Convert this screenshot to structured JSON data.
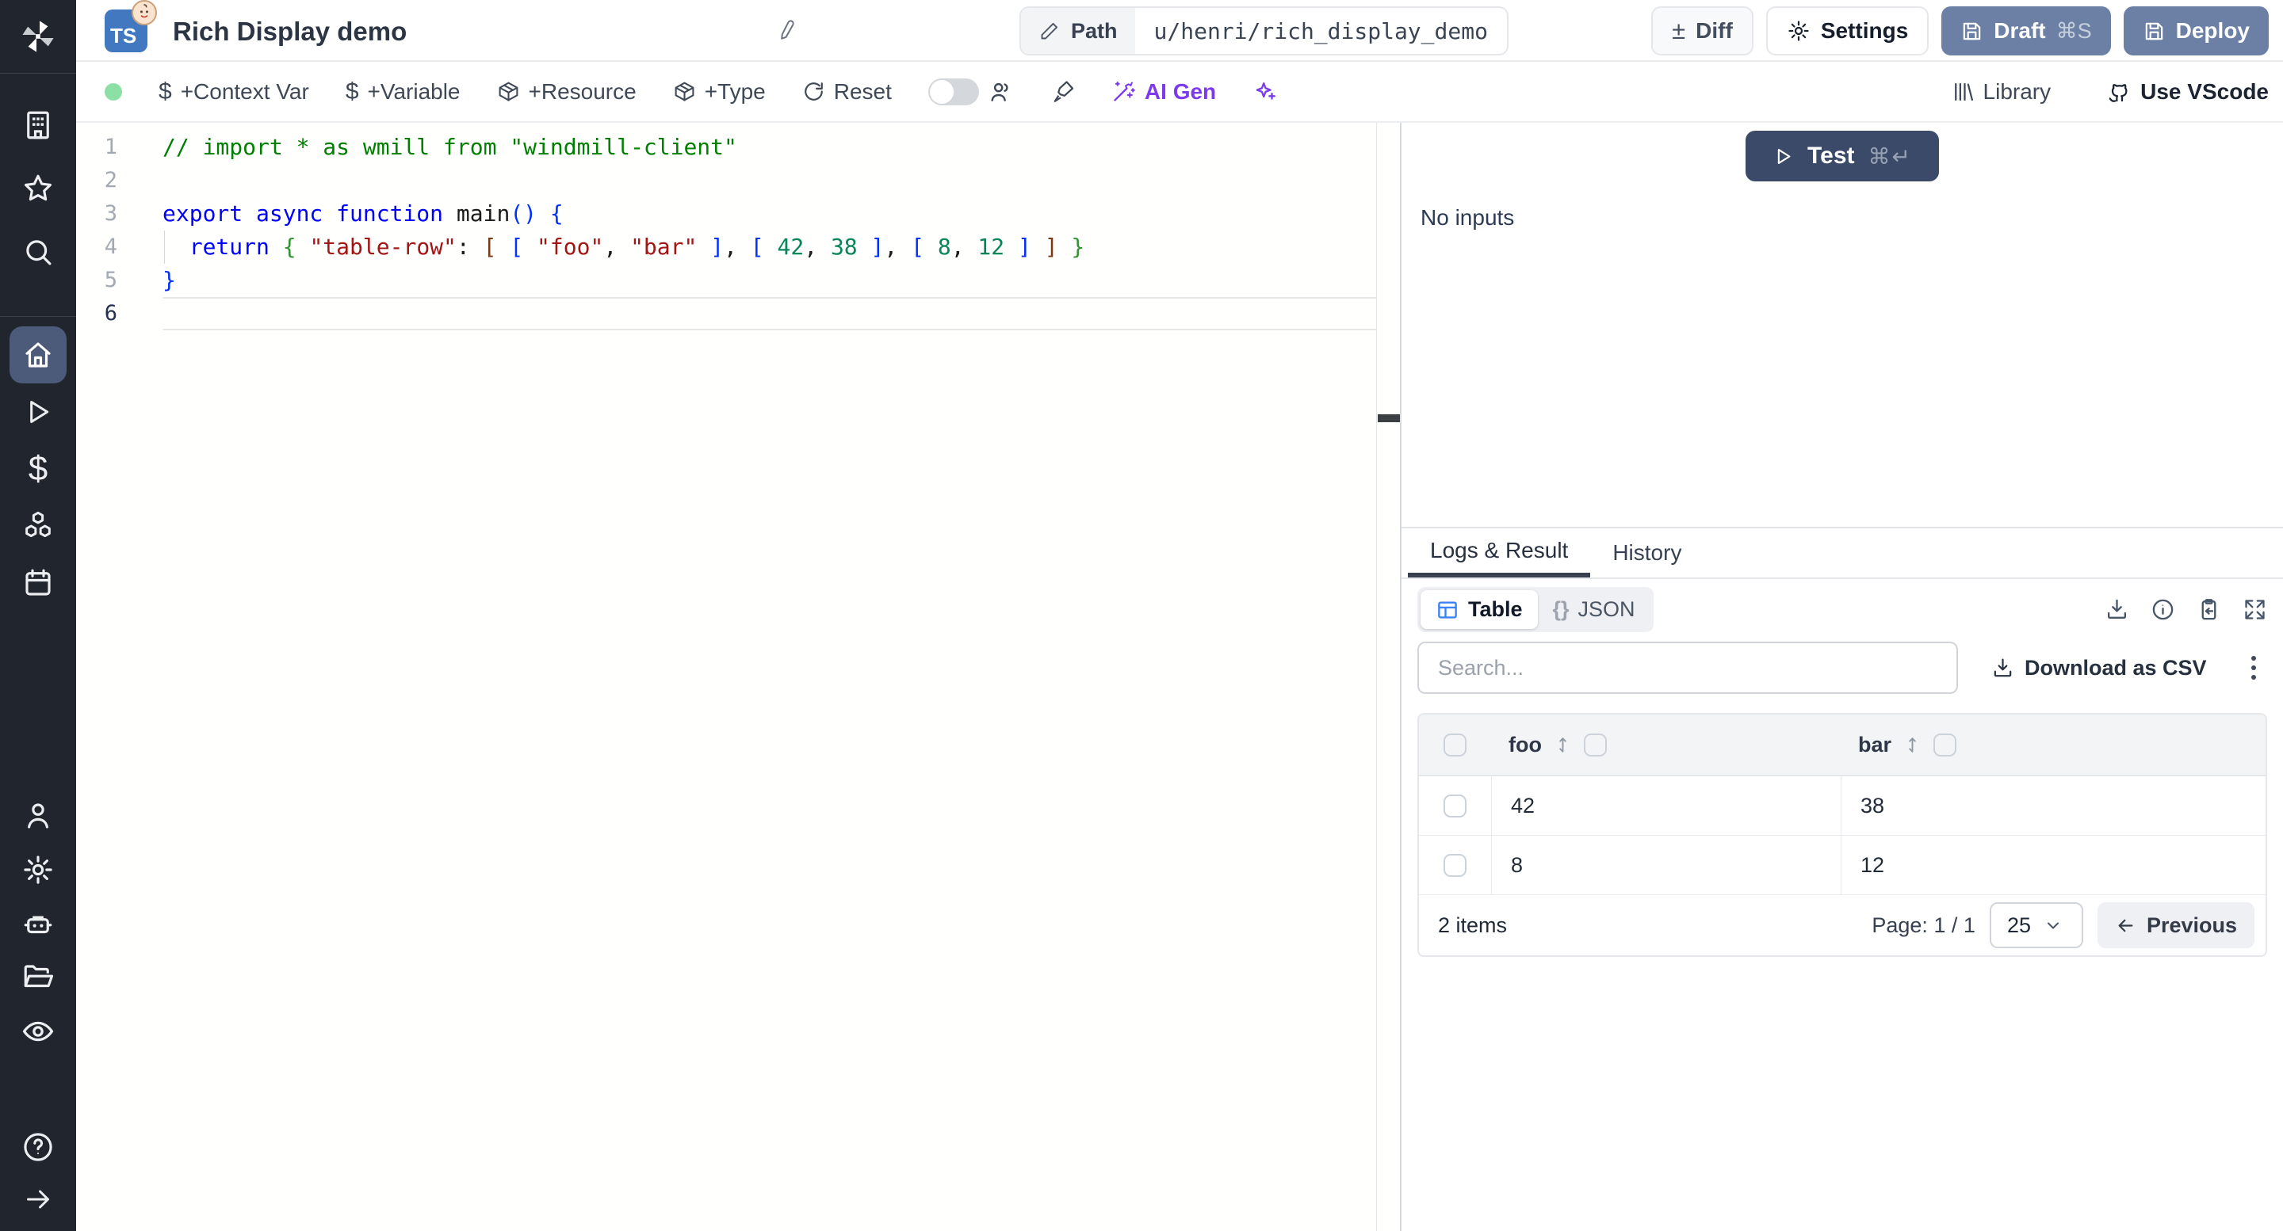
{
  "topbar": {
    "title": "Rich Display demo",
    "language_badge": "TS",
    "path": {
      "label": "Path",
      "value": "u/henri/rich_display_demo"
    },
    "diff_symbol": "±",
    "diff_label": "Diff",
    "settings_label": "Settings",
    "draft_label": "Draft",
    "draft_shortcut": "⌘S",
    "deploy_label": "Deploy"
  },
  "toolbar": {
    "dollar_symbol": "$",
    "context_var_label": "+Context Var",
    "variable_label": "+Variable",
    "resource_label": "+Resource",
    "type_label": "+Type",
    "reset_label": "Reset",
    "ai_gen_label": "AI Gen",
    "library_label": "Library",
    "vscode_label": "Use VScode"
  },
  "editor": {
    "active_line": 6,
    "token_colors": {
      "comment": "#008000",
      "keyword": "#0000ff",
      "string": "#a31515",
      "number": "#098658",
      "plain": "#1b1b1b",
      "b1": "#0431fa",
      "b2": "#319331",
      "b3": "#7b3814",
      "b4": "#0431fa"
    },
    "lines": [
      {
        "num": 1,
        "tokens": [
          [
            "// import * as wmill from \"windmill-client\"",
            "comment"
          ]
        ]
      },
      {
        "num": 2,
        "tokens": []
      },
      {
        "num": 3,
        "tokens": [
          [
            "export async function",
            "keyword"
          ],
          [
            " main",
            "plain"
          ],
          [
            "()",
            "b1"
          ],
          [
            " ",
            "plain"
          ],
          [
            "{",
            "b1"
          ]
        ]
      },
      {
        "num": 4,
        "guide": true,
        "tokens": [
          [
            "  ",
            "plain"
          ],
          [
            "return",
            "keyword"
          ],
          [
            " ",
            "plain"
          ],
          [
            "{",
            "b2"
          ],
          [
            " ",
            "plain"
          ],
          [
            "\"table-row\"",
            "string"
          ],
          [
            ":",
            "plain"
          ],
          [
            " ",
            "plain"
          ],
          [
            "[",
            "b3"
          ],
          [
            " ",
            "plain"
          ],
          [
            "[",
            "b4"
          ],
          [
            " ",
            "plain"
          ],
          [
            "\"foo\"",
            "string"
          ],
          [
            ",",
            "plain"
          ],
          [
            " ",
            "plain"
          ],
          [
            "\"bar\"",
            "string"
          ],
          [
            " ",
            "plain"
          ],
          [
            "]",
            "b4"
          ],
          [
            ",",
            "plain"
          ],
          [
            " ",
            "plain"
          ],
          [
            "[",
            "b4"
          ],
          [
            " ",
            "plain"
          ],
          [
            "42",
            "number"
          ],
          [
            ",",
            "plain"
          ],
          [
            " ",
            "plain"
          ],
          [
            "38",
            "number"
          ],
          [
            " ",
            "plain"
          ],
          [
            "]",
            "b4"
          ],
          [
            ",",
            "plain"
          ],
          [
            " ",
            "plain"
          ],
          [
            "[",
            "b4"
          ],
          [
            " ",
            "plain"
          ],
          [
            "8",
            "number"
          ],
          [
            ",",
            "plain"
          ],
          [
            " ",
            "plain"
          ],
          [
            "12",
            "number"
          ],
          [
            " ",
            "plain"
          ],
          [
            "]",
            "b4"
          ],
          [
            " ",
            "plain"
          ],
          [
            "]",
            "b3"
          ],
          [
            " ",
            "plain"
          ],
          [
            "}",
            "b2"
          ]
        ]
      },
      {
        "num": 5,
        "tokens": [
          [
            "}",
            "b1"
          ]
        ]
      },
      {
        "num": 6,
        "tokens": []
      }
    ]
  },
  "run_panel": {
    "test_label": "Test",
    "test_shortcut": "⌘↵",
    "no_inputs_label": "No inputs",
    "tabs": [
      {
        "label": "Logs & Result",
        "active": true
      },
      {
        "label": "History",
        "active": false
      }
    ],
    "view_toggle": {
      "table_label": "Table",
      "json_glyph": "{}",
      "json_label": "JSON"
    },
    "search_placeholder": "Search...",
    "download_csv_label": "Download as CSV"
  },
  "result_table": {
    "columns": [
      "foo",
      "bar"
    ],
    "rows": [
      [
        "42",
        "38"
      ],
      [
        "8",
        "12"
      ]
    ],
    "items_label": "2 items",
    "page_label": "Page: 1 / 1",
    "page_size": "25",
    "previous_label": "Previous"
  },
  "colors": {
    "slate_button": "#6b80a4",
    "test_button_navy": "#3a4a68",
    "ai_purple": "#7c3aed",
    "status_green": "#8ce0a5",
    "table_icon_blue": "#3b82f6"
  }
}
